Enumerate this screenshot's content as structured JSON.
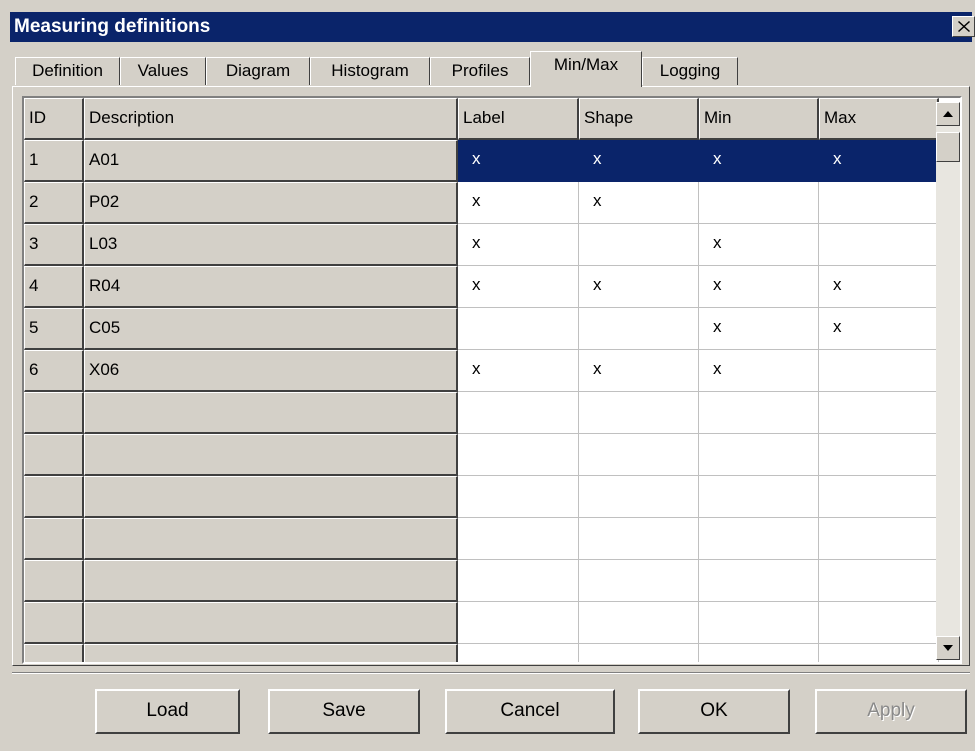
{
  "window": {
    "title": "Measuring definitions"
  },
  "tabs": [
    "Definition",
    "Values",
    "Diagram",
    "Histogram",
    "Profiles",
    "Min/Max",
    "Logging"
  ],
  "active_tab": "Min/Max",
  "table": {
    "columns": [
      "ID",
      "Description",
      "Label",
      "Shape",
      "Min",
      "Max"
    ],
    "rows": [
      {
        "id": "1",
        "description": "A01",
        "label": "x",
        "shape": "x",
        "min": "x",
        "max": "x",
        "selected": true
      },
      {
        "id": "2",
        "description": "P02",
        "label": "x",
        "shape": "x",
        "min": "",
        "max": ""
      },
      {
        "id": "3",
        "description": "L03",
        "label": "x",
        "shape": "",
        "min": "x",
        "max": ""
      },
      {
        "id": "4",
        "description": "R04",
        "label": "x",
        "shape": "x",
        "min": "x",
        "max": "x"
      },
      {
        "id": "5",
        "description": "C05",
        "label": "",
        "shape": "",
        "min": "x",
        "max": "x"
      },
      {
        "id": "6",
        "description": "X06",
        "label": "x",
        "shape": "x",
        "min": "x",
        "max": ""
      }
    ],
    "empty_rows": 7
  },
  "buttons": {
    "load": "Load",
    "save": "Save",
    "cancel": "Cancel",
    "ok": "OK",
    "apply": "Apply"
  },
  "colors": {
    "titlebar": "#0a246a",
    "face": "#d4d0c8",
    "selection": "#0a246a"
  },
  "icons": {
    "close": "close-icon",
    "scroll_up": "arrow-up-icon",
    "scroll_down": "arrow-down-icon"
  }
}
